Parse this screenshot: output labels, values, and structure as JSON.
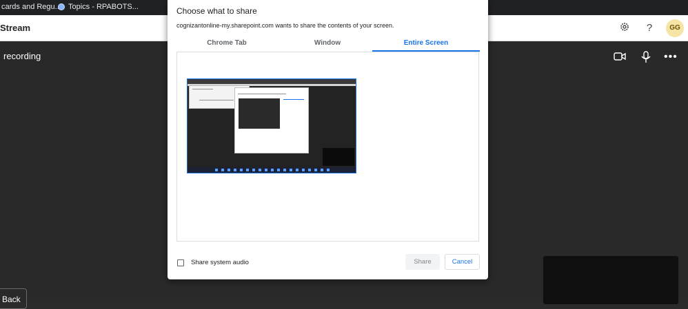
{
  "bookmarks": {
    "items": [
      {
        "label": "cards and Regu..."
      },
      {
        "label": "Topics - RPABOTS...",
        "icon": "globe-icon"
      }
    ]
  },
  "appbar": {
    "title": "Stream",
    "avatar_initials": "GG",
    "icons": [
      "gear-icon",
      "help-icon"
    ]
  },
  "stage": {
    "recording_label": "recording",
    "back_label": "Back",
    "icons": [
      "camera-icon",
      "microphone-icon",
      "more-icon"
    ]
  },
  "dialog": {
    "title": "Choose what to share",
    "subtitle": "cognizantonline-my.sharepoint.com wants to share the contents of your screen.",
    "tabs": [
      {
        "label": "Chrome Tab",
        "active": false
      },
      {
        "label": "Window",
        "active": false
      },
      {
        "label": "Entire Screen",
        "active": true
      }
    ],
    "audio_label": "Share system audio",
    "audio_checked": false,
    "share_label": "Share",
    "cancel_label": "Cancel"
  },
  "colors": {
    "accent": "#1a73e8",
    "stage_bg": "#292929",
    "bookmarks_bg": "#202124",
    "avatar_bg": "#f6e3a6"
  }
}
